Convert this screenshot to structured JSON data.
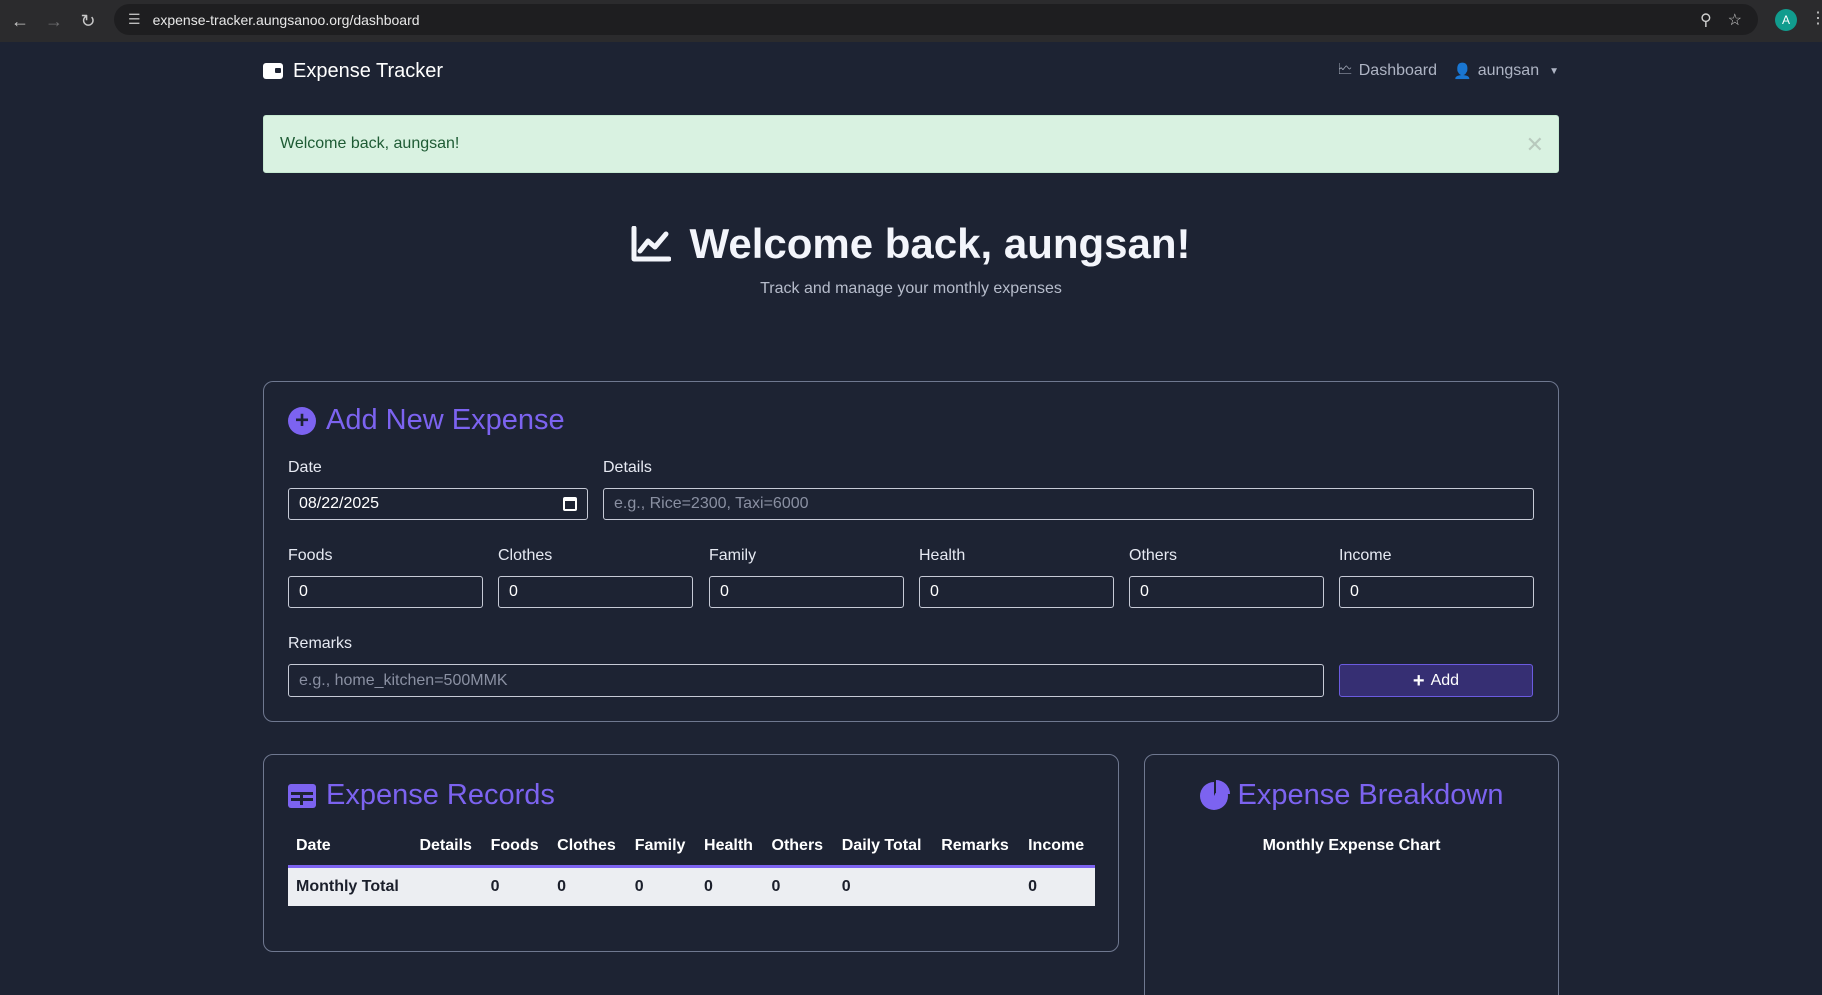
{
  "browser": {
    "url": "expense-tracker.aungsanoo.org/dashboard",
    "profile_initial": "A"
  },
  "nav": {
    "brand": "Expense Tracker",
    "dashboard_label": "Dashboard",
    "user_label": "aungsan"
  },
  "alert": {
    "message": "Welcome back, aungsan!"
  },
  "hero": {
    "title": "Welcome back, aungsan!",
    "subtitle": "Track and manage your monthly expenses"
  },
  "add_expense": {
    "title": "Add New Expense",
    "date_label": "Date",
    "date_value": "08/22/2025",
    "details_label": "Details",
    "details_placeholder": "e.g., Rice=2300, Taxi=6000",
    "foods_label": "Foods",
    "foods_value": "0",
    "clothes_label": "Clothes",
    "clothes_value": "0",
    "family_label": "Family",
    "family_value": "0",
    "health_label": "Health",
    "health_value": "0",
    "others_label": "Others",
    "others_value": "0",
    "income_label": "Income",
    "income_value": "0",
    "remarks_label": "Remarks",
    "remarks_placeholder": "e.g., home_kitchen=500MMK",
    "add_button": "Add"
  },
  "records": {
    "title": "Expense Records",
    "columns": [
      "Date",
      "Details",
      "Foods",
      "Clothes",
      "Family",
      "Health",
      "Others",
      "Daily Total",
      "Remarks",
      "Income"
    ],
    "total_row": [
      "Monthly Total",
      "",
      "0",
      "0",
      "0",
      "0",
      "0",
      "0",
      "",
      "0"
    ]
  },
  "breakdown": {
    "title": "Expense Breakdown",
    "chart_title": "Monthly Expense Chart"
  },
  "colors": {
    "accent": "#7c63f0",
    "background": "#1d2333",
    "alert_bg": "#d9f2e1"
  }
}
